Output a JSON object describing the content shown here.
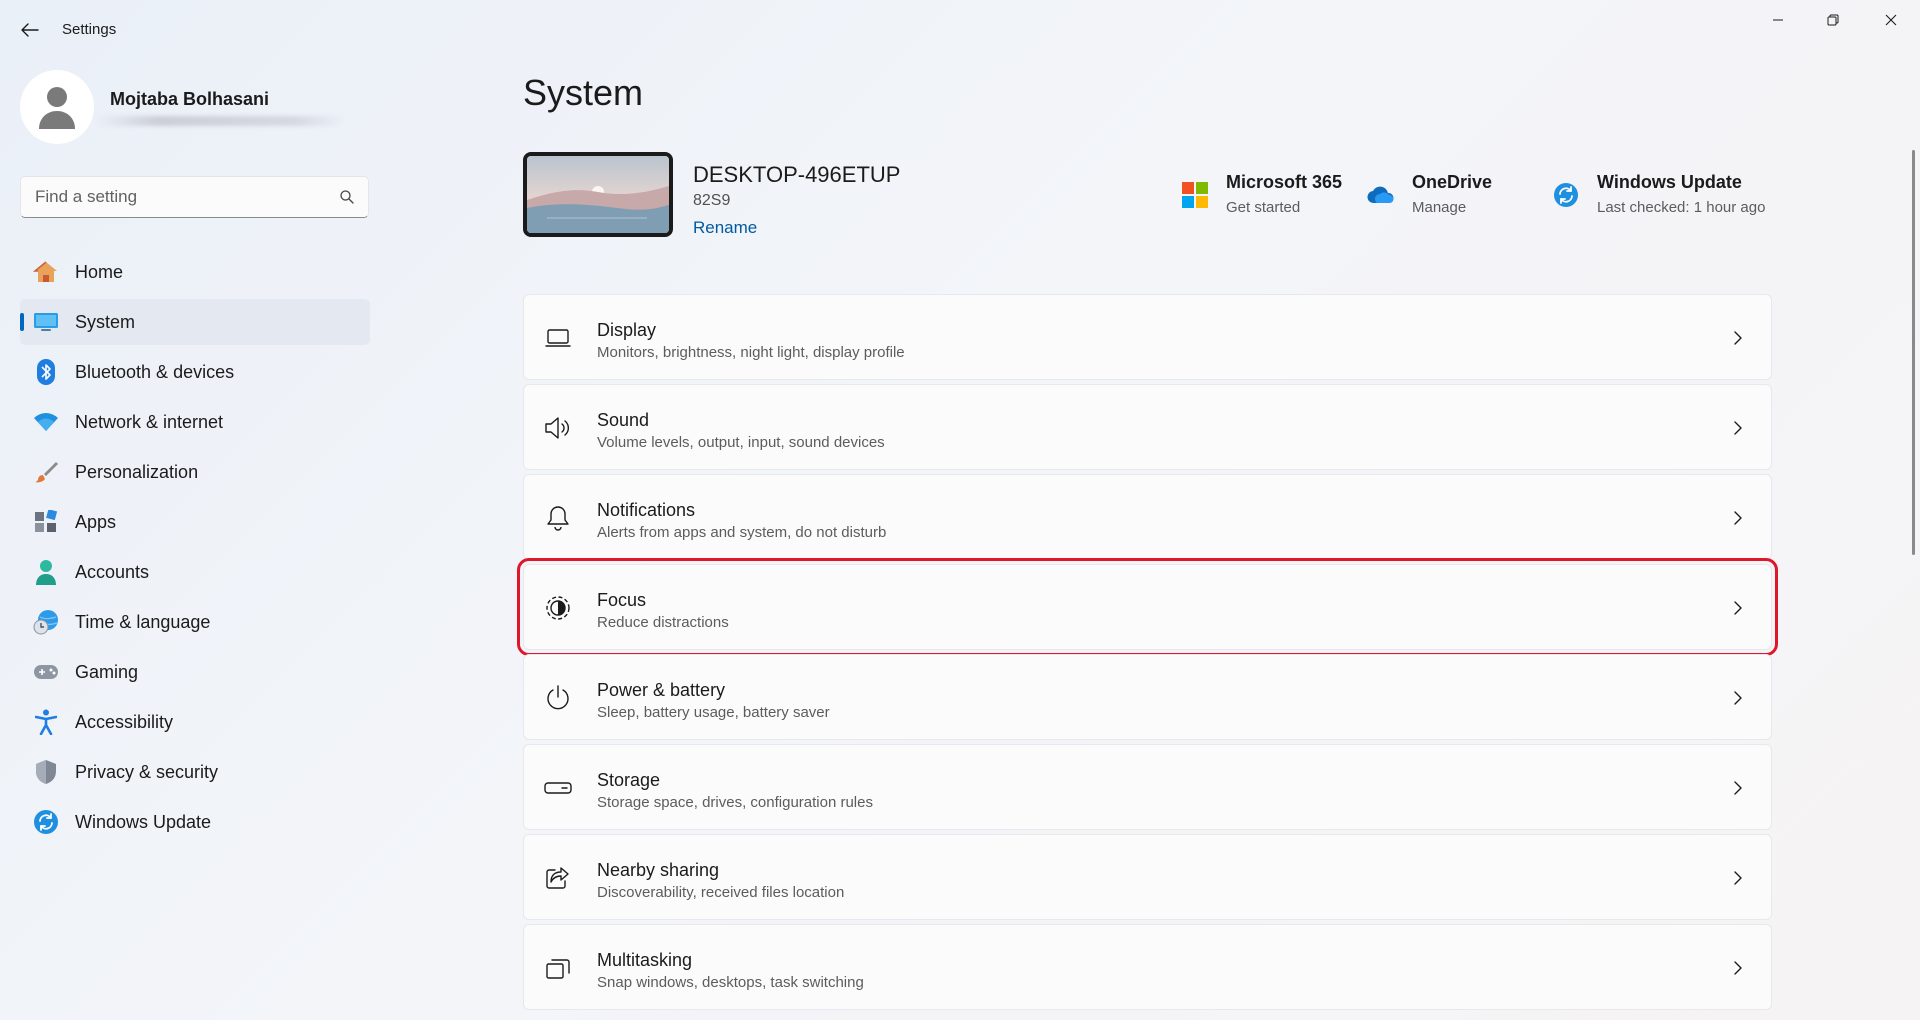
{
  "window": {
    "title": "Settings"
  },
  "profile": {
    "name": "Mojtaba Bolhasani"
  },
  "search": {
    "placeholder": "Find a setting"
  },
  "sidebar": {
    "items": [
      {
        "label": "Home",
        "icon": "home-icon",
        "active": false
      },
      {
        "label": "System",
        "icon": "system-icon",
        "active": true
      },
      {
        "label": "Bluetooth & devices",
        "icon": "bluetooth-icon",
        "active": false
      },
      {
        "label": "Network & internet",
        "icon": "wifi-icon",
        "active": false
      },
      {
        "label": "Personalization",
        "icon": "brush-icon",
        "active": false
      },
      {
        "label": "Apps",
        "icon": "apps-icon",
        "active": false
      },
      {
        "label": "Accounts",
        "icon": "account-icon",
        "active": false
      },
      {
        "label": "Time & language",
        "icon": "clock-globe-icon",
        "active": false
      },
      {
        "label": "Gaming",
        "icon": "gamepad-icon",
        "active": false
      },
      {
        "label": "Accessibility",
        "icon": "accessibility-icon",
        "active": false
      },
      {
        "label": "Privacy & security",
        "icon": "shield-icon",
        "active": false
      },
      {
        "label": "Windows Update",
        "icon": "update-icon",
        "active": false
      }
    ]
  },
  "main": {
    "title": "System",
    "device": {
      "name": "DESKTOP-496ETUP",
      "model": "82S9",
      "rename": "Rename"
    },
    "quick_links": [
      {
        "title": "Microsoft 365",
        "subtitle": "Get started",
        "icon": "microsoft-logo-icon"
      },
      {
        "title": "OneDrive",
        "subtitle": "Manage",
        "icon": "onedrive-cloud-icon"
      },
      {
        "title": "Windows Update",
        "subtitle": "Last checked: 1 hour ago",
        "icon": "update-icon"
      }
    ],
    "settings": [
      {
        "title": "Display",
        "subtitle": "Monitors, brightness, night light, display profile",
        "icon": "laptop-icon",
        "highlighted": false
      },
      {
        "title": "Sound",
        "subtitle": "Volume levels, output, input, sound devices",
        "icon": "speaker-icon",
        "highlighted": false
      },
      {
        "title": "Notifications",
        "subtitle": "Alerts from apps and system, do not disturb",
        "icon": "bell-icon",
        "highlighted": false
      },
      {
        "title": "Focus",
        "subtitle": "Reduce distractions",
        "icon": "focus-timer-icon",
        "highlighted": true
      },
      {
        "title": "Power & battery",
        "subtitle": "Sleep, battery usage, battery saver",
        "icon": "power-icon",
        "highlighted": false
      },
      {
        "title": "Storage",
        "subtitle": "Storage space, drives, configuration rules",
        "icon": "storage-drive-icon",
        "highlighted": false
      },
      {
        "title": "Nearby sharing",
        "subtitle": "Discoverability, received files location",
        "icon": "share-icon",
        "highlighted": false
      },
      {
        "title": "Multitasking",
        "subtitle": "Snap windows, desktops, task switching",
        "icon": "multitasking-icon",
        "highlighted": false
      }
    ]
  },
  "colors": {
    "accent": "#0067c0",
    "highlight_box": "#e0162b",
    "link": "#005a9e"
  }
}
